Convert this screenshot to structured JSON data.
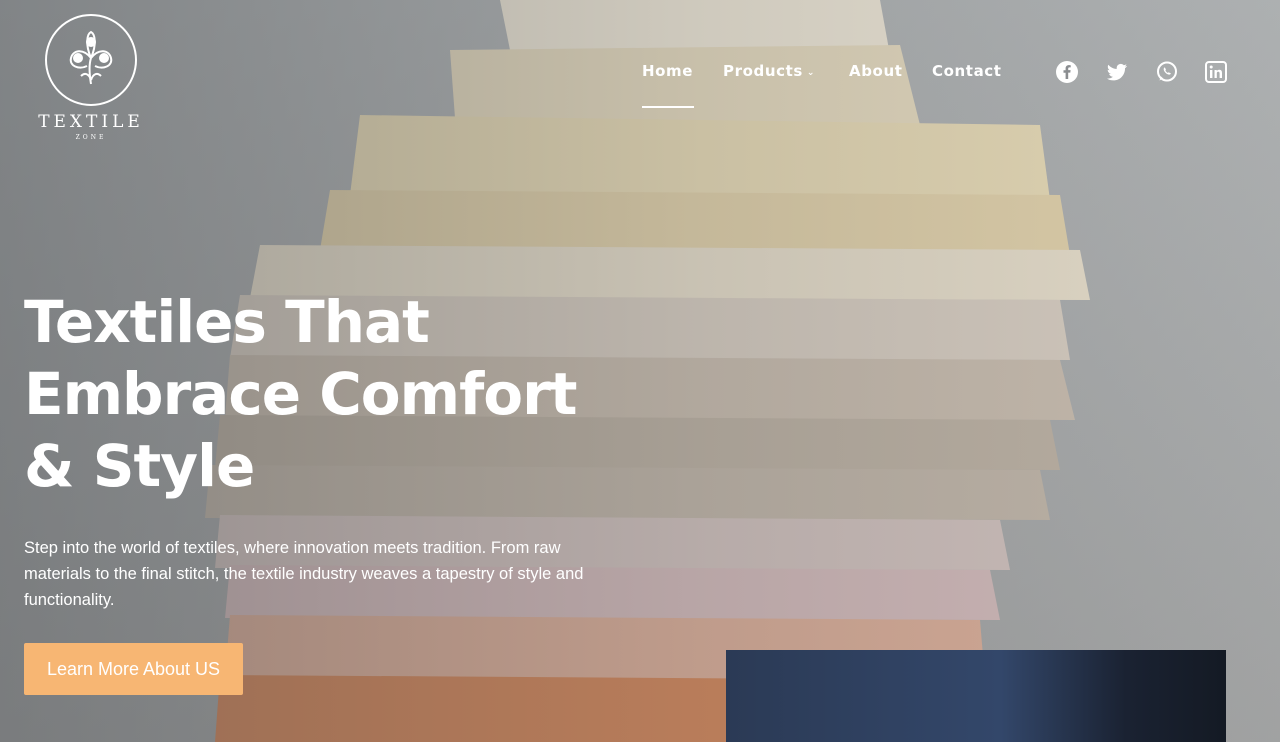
{
  "brand": {
    "name": "TEXTILE",
    "sub": "ZONE",
    "logo_icon": "cotton-flower-icon"
  },
  "nav": {
    "items": [
      {
        "label": "Home",
        "active": true
      },
      {
        "label": "Products",
        "has_dropdown": true
      },
      {
        "label": "About"
      },
      {
        "label": "Contact"
      }
    ],
    "dropdown_icon": "chevron-down-icon"
  },
  "social": [
    "facebook-icon",
    "twitter-icon",
    "whatsapp-icon",
    "linkedin-icon"
  ],
  "hero": {
    "headline_lines": [
      "Textiles That",
      "Embrace Comfort",
      "& Style"
    ],
    "description": "Step into the world of textiles, where innovation meets tradition. From raw materials to the final stitch, the textile industry weaves a tapestry of style and functionality.",
    "cta_label": "Learn More About US"
  },
  "colors": {
    "accent": "#f7b673",
    "text": "#ffffff",
    "panel": "#2b3a55"
  }
}
